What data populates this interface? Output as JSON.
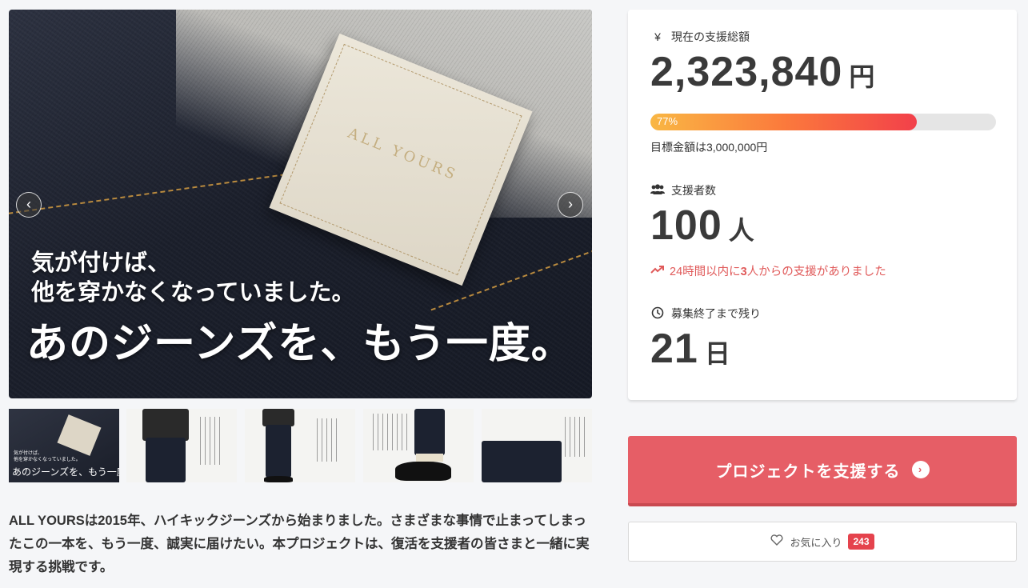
{
  "hero": {
    "patch_text": "ALL YOURS",
    "copy_line1": "気が付けば、",
    "copy_line2": "他を穿かなくなっていました。",
    "copy_main": "あのジーンズを、もう一度。",
    "prev_label": "‹",
    "next_label": "›"
  },
  "thumbnails": {
    "t1_line1": "気が付けば、",
    "t1_line2": "他を穿かなくなっていました。",
    "t1_main": "あのジーンズを、もう一度。"
  },
  "description": "ALL YOURSは2015年、ハイキックジーンズから始まりました。さまざまな事情で止まってしまったこの一本を、もう一度、誠実に届けたい。本プロジェクトは、復活を支援者の皆さまと一緒に実現する挑戦です。",
  "stats": {
    "amount_label": "現在の支援総額",
    "amount_icon": "¥",
    "amount_value": "2,323,840",
    "amount_unit": "円",
    "progress_percent": 77,
    "progress_label": "77%",
    "goal_text": "目標金額は3,000,000円",
    "backers_label": "支援者数",
    "backers_value": "100",
    "backers_unit": "人",
    "trend_prefix": "24時間以内に",
    "trend_count": "3",
    "trend_suffix": "人からの支援がありました",
    "remaining_label": "募集終了まで残り",
    "remaining_value": "21",
    "remaining_unit": "日"
  },
  "actions": {
    "support_label": "プロジェクトを支援する",
    "support_arrow": "›",
    "favorite_label": "お気に入り",
    "favorite_count": "243"
  },
  "colors": {
    "accent": "#e65e66",
    "progress_start": "#f9b744",
    "progress_end": "#f2404a",
    "trend": "#e05a5a",
    "badge": "#e5434d"
  }
}
